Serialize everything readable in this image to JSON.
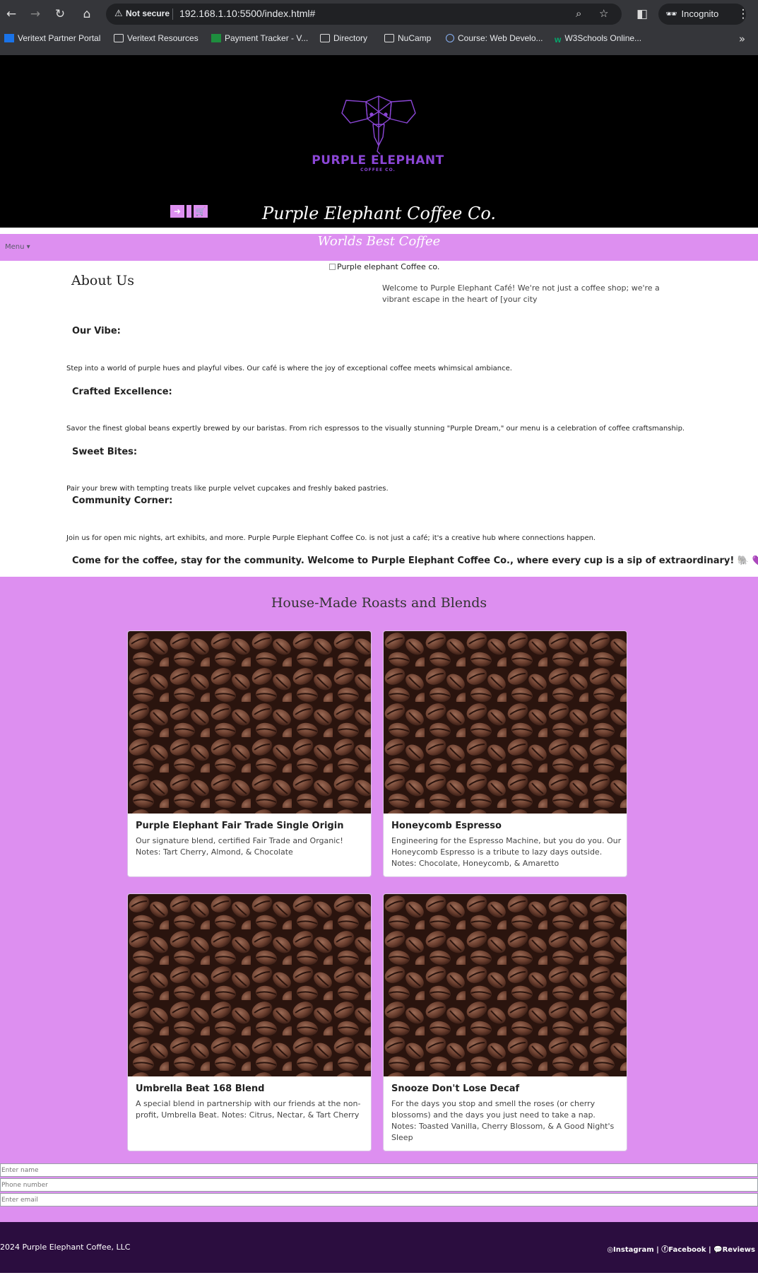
{
  "browser": {
    "not_secure": "Not secure",
    "url": "192.168.1.10:5500/index.html#",
    "incognito": "Incognito",
    "bookmarks": [
      {
        "label": "Veritext Partner Portal",
        "icon": "veritext-icon"
      },
      {
        "label": "Veritext Resources",
        "icon": "folder-icon"
      },
      {
        "label": "Payment Tracker - V...",
        "icon": "sheets-icon"
      },
      {
        "label": "Directory",
        "icon": "folder-icon"
      },
      {
        "label": "NuCamp",
        "icon": "folder-icon"
      },
      {
        "label": "Course: Web Develo...",
        "icon": "course-icon"
      },
      {
        "label": "W3Schools Online...",
        "icon": "w3schools-icon"
      }
    ]
  },
  "hero": {
    "logo_name": "PURPLE ELEPHANT",
    "logo_sub": "COFFEE CO.",
    "title": "Purple Elephant Coffee Co.",
    "login_icon": "sign-in-icon",
    "cart_icon": "cart-icon"
  },
  "band": {
    "tagline": "Worlds Best Coffee",
    "menu_label": "Menu"
  },
  "about": {
    "image_alt": "Purple elephant Coffee co.",
    "heading": "About Us",
    "intro": "Welcome to Purple Elephant Café! We're not just a coffee shop; we're a vibrant escape in the heart of [your city",
    "sections": [
      {
        "title": "Our Vibe:",
        "text": "Step into a world of purple hues and playful vibes. Our café is where the joy of exceptional coffee meets whimsical ambiance."
      },
      {
        "title": "Crafted Excellence:",
        "text": "Savor the finest global beans expertly brewed by our baristas. From rich espressos to the visually stunning \"Purple Dream,\" our menu is a celebration of coffee craftsmanship."
      },
      {
        "title": "Sweet Bites:",
        "text": "Pair your brew with tempting treats like purple velvet cupcakes and freshly baked pastries."
      },
      {
        "title": "Community Corner:",
        "text": "Join us for open mic nights, art exhibits, and more. Purple Purple Elephant Coffee Co. is not just a café; it's a creative hub where connections happen."
      }
    ],
    "closing": "Come for the coffee, stay for the community. Welcome to Purple Elephant Coffee Co., where every cup is a sip of extraordinary!",
    "closing_emoji": "🐘 💜"
  },
  "products": {
    "heading": "House-Made Roasts and Blends",
    "items": [
      {
        "title": "Purple Elephant Fair Trade Single Origin",
        "text": "Our signature blend, certified Fair Trade and Organic! Notes: Tart Cherry, Almond, & Chocolate"
      },
      {
        "title": "Honeycomb Espresso",
        "text": "Engineering for the Espresso Machine, but you do you. Our Honeycomb Espresso is a tribute to lazy days outside. Notes: Chocolate, Honeycomb, & Amaretto"
      },
      {
        "title": "Umbrella Beat 168 Blend",
        "text": "A special blend in partnership with our friends at the non-profit, Umbrella Beat. Notes: Citrus, Nectar, & Tart Cherry"
      },
      {
        "title": "Snooze Don't Lose Decaf",
        "text": "For the days you stop and smell the roses (or cherry blossoms) and the days you just need to take a nap. Notes: Toasted Vanilla, Cherry Blossom, & A Good Night's Sleep"
      }
    ]
  },
  "form": {
    "name_placeholder": "Enter name",
    "phone_placeholder": "Phone number",
    "email_placeholder": "Enter email"
  },
  "footer": {
    "copyright": "2024 Purple Elephant Coffee, LLC",
    "links": [
      "Instagram",
      "Facebook",
      "Reviews"
    ]
  }
}
